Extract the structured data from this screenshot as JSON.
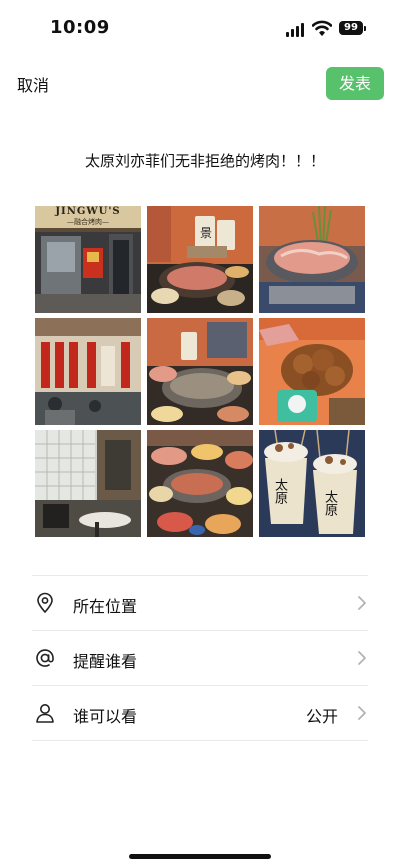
{
  "status_bar": {
    "time": "10:09",
    "battery": "99"
  },
  "header": {
    "cancel_label": "取消",
    "publish_label": "发表",
    "publish_color": "#58c16c"
  },
  "post": {
    "text": "太原刘亦菲们无非拒绝的烤肉！！！"
  },
  "photos": {
    "count": 9,
    "tile1": {
      "sign": "JINGWU'S",
      "subtitle": "—融合烤肉—"
    },
    "tile2": {
      "cup_label": "景"
    },
    "tile9": {
      "cup_label_left": "太原",
      "cup_label_right": "太原"
    }
  },
  "options": [
    {
      "label": "所在位置",
      "icon": "location-pin-icon",
      "value": ""
    },
    {
      "label": "提醒谁看",
      "icon": "at-sign-icon",
      "value": ""
    },
    {
      "label": "谁可以看",
      "icon": "person-icon",
      "value": "公开"
    }
  ]
}
